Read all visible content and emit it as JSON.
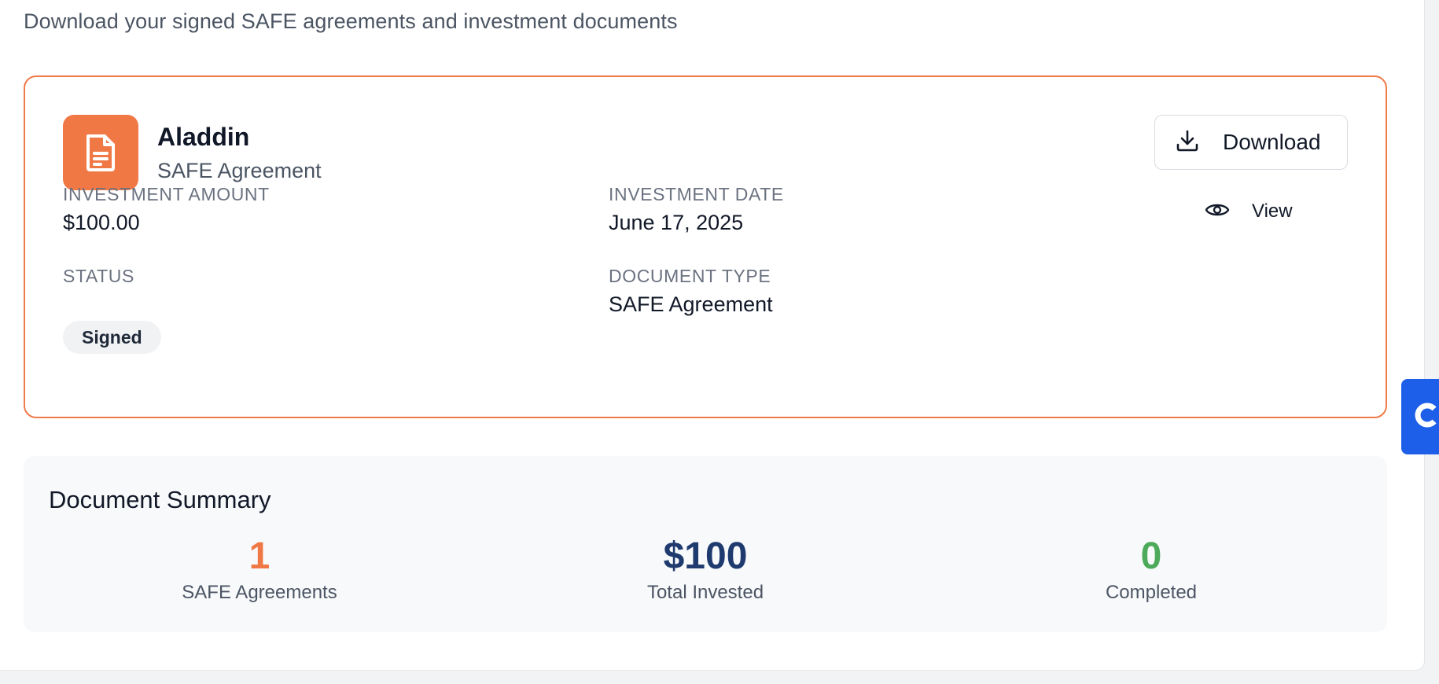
{
  "page": {
    "subtitle": "Download your signed SAFE agreements and investment documents"
  },
  "document": {
    "icon": "document-icon",
    "name": "Aladdin",
    "type": "SAFE Agreement",
    "fields": {
      "amount_label": "INVESTMENT AMOUNT",
      "amount_value": "$100.00",
      "date_label": "INVESTMENT DATE",
      "date_value": "June 17, 2025",
      "status_label": "STATUS",
      "status_value": "Signed",
      "doctype_label": "DOCUMENT TYPE",
      "doctype_value": "SAFE Agreement"
    },
    "actions": {
      "download_label": "Download",
      "download_icon": "download-icon",
      "view_label": "View",
      "view_icon": "eye-icon"
    }
  },
  "summary": {
    "title": "Document Summary",
    "stats": [
      {
        "value": "1",
        "label": "SAFE Agreements",
        "color": "#f07845"
      },
      {
        "value": "$100",
        "label": "Total Invested",
        "color": "#1e3a6e"
      },
      {
        "value": "0",
        "label": "Completed",
        "color": "#4caa5a"
      }
    ]
  },
  "colors": {
    "accent": "#f07845",
    "card_border": "#ef7a4a",
    "chat_tab": "#1d5fe8"
  }
}
